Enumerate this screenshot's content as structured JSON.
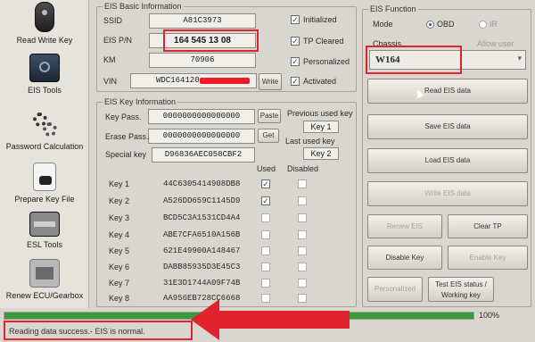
{
  "sidebar": {
    "items": [
      {
        "label": "Read Write Key",
        "icon": "car-key-icon"
      },
      {
        "label": "EIS Tools",
        "icon": "ignition-switch-icon"
      },
      {
        "label": "Password Calculation",
        "icon": "gears-icon"
      },
      {
        "label": "Prepare Key File",
        "icon": "key-file-icon"
      },
      {
        "label": "ESL Tools",
        "icon": "steering-lock-icon"
      },
      {
        "label": "Renew ECU/Gearbox",
        "icon": "ecu-icon"
      }
    ]
  },
  "eis_basic": {
    "title": "EIS Basic Information",
    "ssid_label": "SSID",
    "ssid": "A81C3973",
    "pn_label": "EIS P/N",
    "pn": "164 545 13 08",
    "km_label": "KM",
    "km": "70906",
    "vin_label": "VIN",
    "vin": "WDC164120",
    "write_label": "Write",
    "flags": [
      {
        "label": "Initialized",
        "checked": true
      },
      {
        "label": "TP Cleared",
        "checked": true
      },
      {
        "label": "Personalized",
        "checked": true
      },
      {
        "label": "Activated",
        "checked": true
      }
    ]
  },
  "eis_function": {
    "title": "EIS Function",
    "mode_label": "Mode",
    "mode_obd": "OBD",
    "mode_ir": "IR",
    "chassis_label": "Chassis",
    "allow_user": "Allow user",
    "chassis_value": "W164",
    "buttons": {
      "read": "Read EIS data",
      "save": "Save EIS data",
      "load": "Load EIS data",
      "write": "Write EIS data",
      "renew": "Renew EIS",
      "clear_tp": "Clear TP",
      "disable_key": "Disable Key",
      "enable_key": "Enable Key",
      "personalized": "Personalized",
      "test_eis": "Test EIS status / Working key"
    }
  },
  "key_info": {
    "title": "EIS Key Information",
    "key_pass_label": "Key Pass.",
    "key_pass": "0000000000000000",
    "erase_pass_label": "Erase Pass.",
    "erase_pass": "0000000000000000",
    "special_label": "Special key",
    "special": "D96836AEC058CBF2",
    "paste": "Paste",
    "get": "Get",
    "prev_used_label": "Previous used key",
    "prev_used": "Key 1",
    "last_used_label": "Last used key",
    "last_used": "Key 2",
    "used_header": "Used",
    "disabled_header": "Disabled",
    "keys": [
      {
        "name": "Key 1",
        "value": "44C6305414908DB8",
        "used": true
      },
      {
        "name": "Key 2",
        "value": "A526DD659C1145D9",
        "used": true
      },
      {
        "name": "Key 3",
        "value": "BCD5C3A1531CD4A4",
        "used": false
      },
      {
        "name": "Key 4",
        "value": "ABE7CFA6510A156B",
        "used": false
      },
      {
        "name": "Key 5",
        "value": "621E49900A148467",
        "used": false
      },
      {
        "name": "Key 6",
        "value": "DABB85935D3E45C3",
        "used": false
      },
      {
        "name": "Key 7",
        "value": "31E3D1744A09F74B",
        "used": false
      },
      {
        "name": "Key 8",
        "value": "AA956EB728CC6668",
        "used": false
      }
    ]
  },
  "status": {
    "progress_percent": 100,
    "percent_text": "100%",
    "message": "Reading data success.- EIS is normal."
  },
  "colors": {
    "annotation_red": "#e0232c",
    "progress_green": "#3a9a3a"
  }
}
